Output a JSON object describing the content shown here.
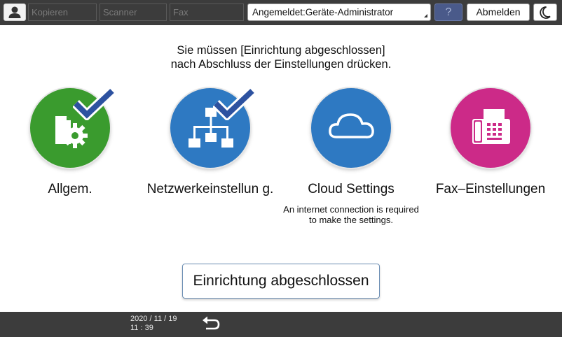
{
  "topbar": {
    "tabs": [
      "Kopieren",
      "Scanner",
      "Fax"
    ],
    "login_status": "Angemeldet:Geräte-Administrator",
    "help_label": "?",
    "logout_label": "Abmelden"
  },
  "message": {
    "line1": "Sie müssen [Einrichtung abgeschlossen]",
    "line2": "nach Abschluss der Einstellungen drücken."
  },
  "tiles": [
    {
      "label": "Allgem.",
      "sub": "",
      "color": "#3a9b2e",
      "icon": "general-settings-icon",
      "checked": true
    },
    {
      "label": "Netzwerkeinstellun g.",
      "sub": "",
      "color": "#2e79c2",
      "icon": "network-icon",
      "checked": true
    },
    {
      "label": "Cloud Settings",
      "sub": "An internet connection is required to make the settings.",
      "color": "#2e79c2",
      "icon": "cloud-icon",
      "checked": false
    },
    {
      "label": "Fax–Einstellungen",
      "sub": "",
      "color": "#cc2a88",
      "icon": "fax-icon",
      "checked": false
    }
  ],
  "finish_button": "Einrichtung abgeschlossen",
  "footer": {
    "date": "2020 / 11 / 19",
    "time": "11 : 39"
  },
  "colors": {
    "check": "#2d52a0",
    "bar": "#3c3c3c"
  }
}
